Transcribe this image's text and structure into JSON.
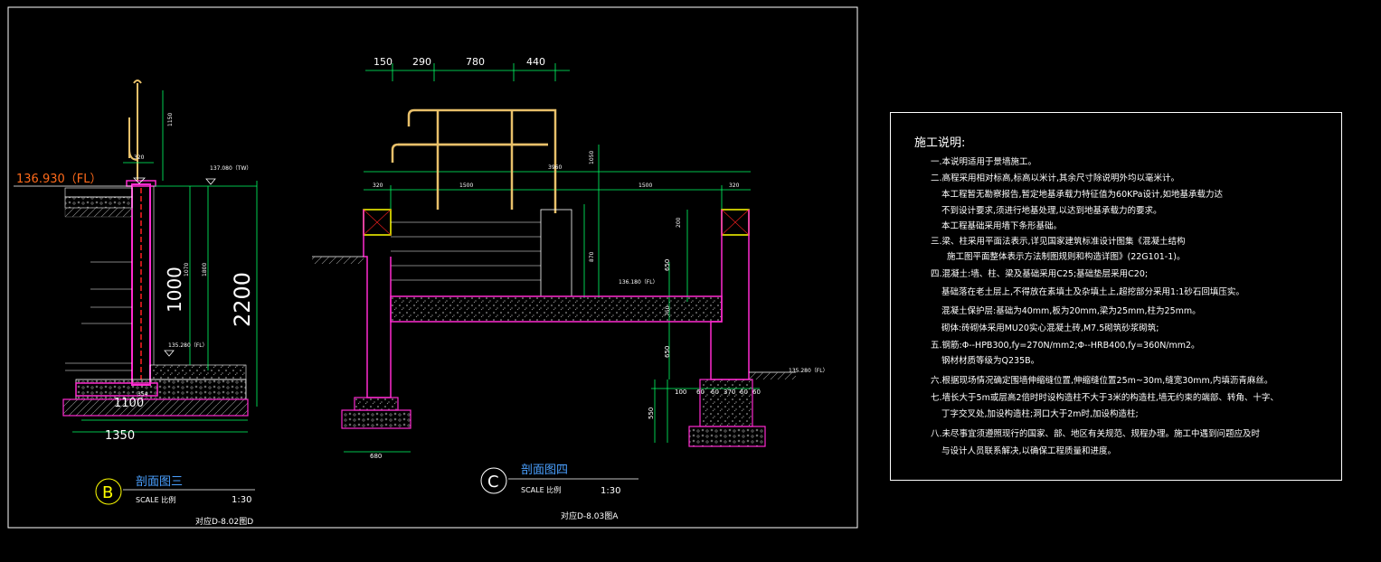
{
  "section_b": {
    "level_fl": "136.930（FL）",
    "level_tw": "137.080（TW）",
    "level_fl2": "135.280（FL）",
    "dim_big": "2200",
    "dim_mid": "1000",
    "dim_1100": "1100",
    "dim_1350": "1350",
    "dim_150": "150",
    "dim_1150": "1150",
    "dim_1800": "1800",
    "dim_1070": "1070",
    "dim_320": "320",
    "dim_354": "354",
    "label_b": "B",
    "name": "剖面图三",
    "scale_label": "SCALE 比例",
    "scale_val": "1:30",
    "ref": "对应D-8.02图D"
  },
  "section_c": {
    "top_dims": [
      "150",
      "290",
      "780",
      "440"
    ],
    "dim_3960": "3960",
    "dim_1500a": "1500",
    "dim_1500b": "1500",
    "dim_320a": "320",
    "dim_320b": "320",
    "dim_1050": "1050",
    "dim_870": "870",
    "dim_200": "200",
    "dim_650a": "650",
    "dim_650b": "650",
    "dim_750": "750",
    "dim_550": "550",
    "dim_680": "680",
    "level_136": "136.180（FL）",
    "level_135": "135.280（FL）",
    "bottom_dims": [
      "100",
      "60",
      "60",
      "370",
      "60",
      "60"
    ],
    "label_c": "C",
    "name": "剖面图四",
    "scale_label": "SCALE 比例",
    "scale_val": "1:30",
    "ref": "对应D-8.03图A"
  },
  "notes": {
    "title": "施工说明:",
    "lines": [
      "一.本说明适用于景墙施工。",
      "二.高程采用相对标高,标高以米计,其余尺寸除说明外均以毫米计。",
      "本工程暂无勘察报告,暂定地基承载力特征值为60KPa设计,如地基承载力达",
      "不到设计要求,须进行地基处理,以达到地基承载力的要求。",
      "本工程基础采用墙下条形基础。",
      "三.梁、柱采用平面法表示,详见国家建筑标准设计图集《混凝土结构",
      "施工图平面整体表示方法制图规则和构造详图》(22G101-1)。",
      "四.混凝土:墙、柱、梁及基础采用C25;基础垫层采用C20;",
      "基础落在老土层上,不得放在素填土及杂填土上,超挖部分采用1:1砂石回填压实。",
      "混凝土保护层:基础为40mm,板为20mm,梁为25mm,柱为25mm。",
      "砌体:砖砌体采用MU20实心混凝土砖,M7.5砌筑砂浆砌筑;",
      "五.钢筋:Φ--HPB300,fy=270N/mm2;Φ--HRB400,fy=360N/mm2。",
      "钢材材质等级为Q235B。",
      "六.根据现场情况确定围墙伸缩缝位置,伸缩缝位置25m~30m,缝宽30mm,内填沥青麻丝。",
      "七.墙长大于5m或层高2倍时时设构造柱不大于3米的构造柱,墙无约束的端部、转角、十字、",
      "丁字交叉处,加设构造柱;洞口大于2m时,加设构造柱;",
      "八.未尽事宜须遵照现行的国家、部、地区有关规范、规程办理。施工中遇到问题应及时",
      "与设计人员联系解决,以确保工程质量和进度。"
    ]
  }
}
